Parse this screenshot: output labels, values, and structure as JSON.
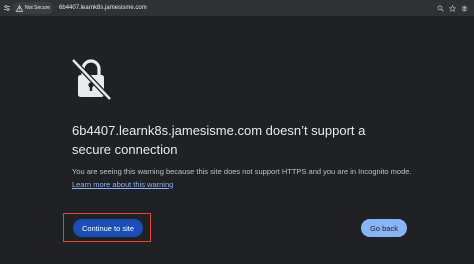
{
  "browser": {
    "security_label": "Not Secure",
    "url": "6b4407.learnk8s.jamesisme.com",
    "icons": [
      "tune-icon",
      "warning-icon",
      "zoom-icon",
      "star-icon",
      "profile-icon"
    ]
  },
  "interstitial": {
    "icon": "broken-lock-icon",
    "heading": "6b4407.learnk8s.jamesisme.com doesn’t support a secure connection",
    "explanation": "You are seeing this warning because this site does not support HTTPS and you are in Incognito mode. ",
    "learn_more": "Learn more about this warning",
    "continue_label": "Continue to site",
    "back_label": "Go back",
    "highlight_color": "#e8442f"
  },
  "colors": {
    "background": "#202124",
    "text": "#e8eaed",
    "secondary_text": "#bdc1c6",
    "link": "#8ab4f8",
    "primary_button": "#1c4eb7",
    "secondary_button": "#8ab4f8"
  }
}
